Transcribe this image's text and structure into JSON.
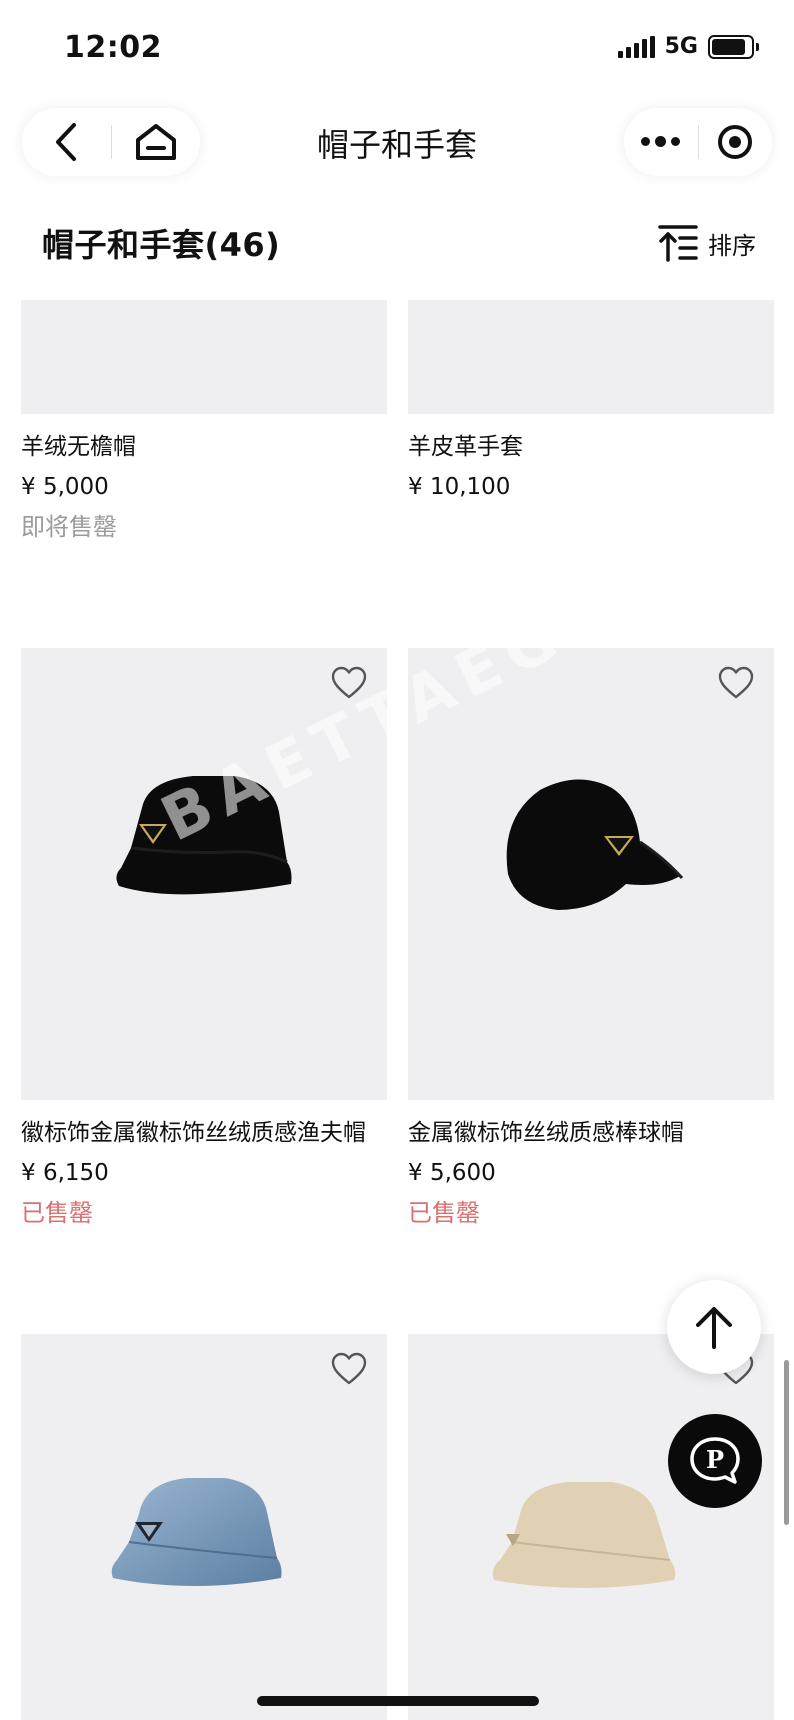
{
  "status_bar": {
    "time": "12:02",
    "network": "5G"
  },
  "nav": {
    "title": "帽子和手套"
  },
  "header": {
    "title": "帽子和手套(46)",
    "sort_label": "排序"
  },
  "products": [
    {
      "name": "羊绒无檐帽",
      "price": "¥ 5,000",
      "status": "即将售罄",
      "status_color": "#9b9b9b"
    },
    {
      "name": "羊皮革手套",
      "price": "¥ 10,100",
      "status": "",
      "status_color": "#9b9b9b"
    },
    {
      "name": "徽标饰金属徽标饰丝绒质感渔夫帽",
      "price": "¥ 6,150",
      "status": "已售罄",
      "status_color": "#d9706f"
    },
    {
      "name": "金属徽标饰丝绒质感棒球帽",
      "price": "¥ 5,600",
      "status": "已售罄",
      "status_color": "#d9706f"
    },
    {
      "name": "",
      "price": "",
      "status": "",
      "status_color": "#9b9b9b"
    },
    {
      "name": "",
      "price": "",
      "status": "",
      "status_color": "#9b9b9b"
    }
  ],
  "watermark": "BAETTAEGI",
  "chat_logo": "P",
  "colors": {
    "image_bg": "#efeff2",
    "sold_out": "#d9706f",
    "coming_soon": "#9b9b9b"
  }
}
